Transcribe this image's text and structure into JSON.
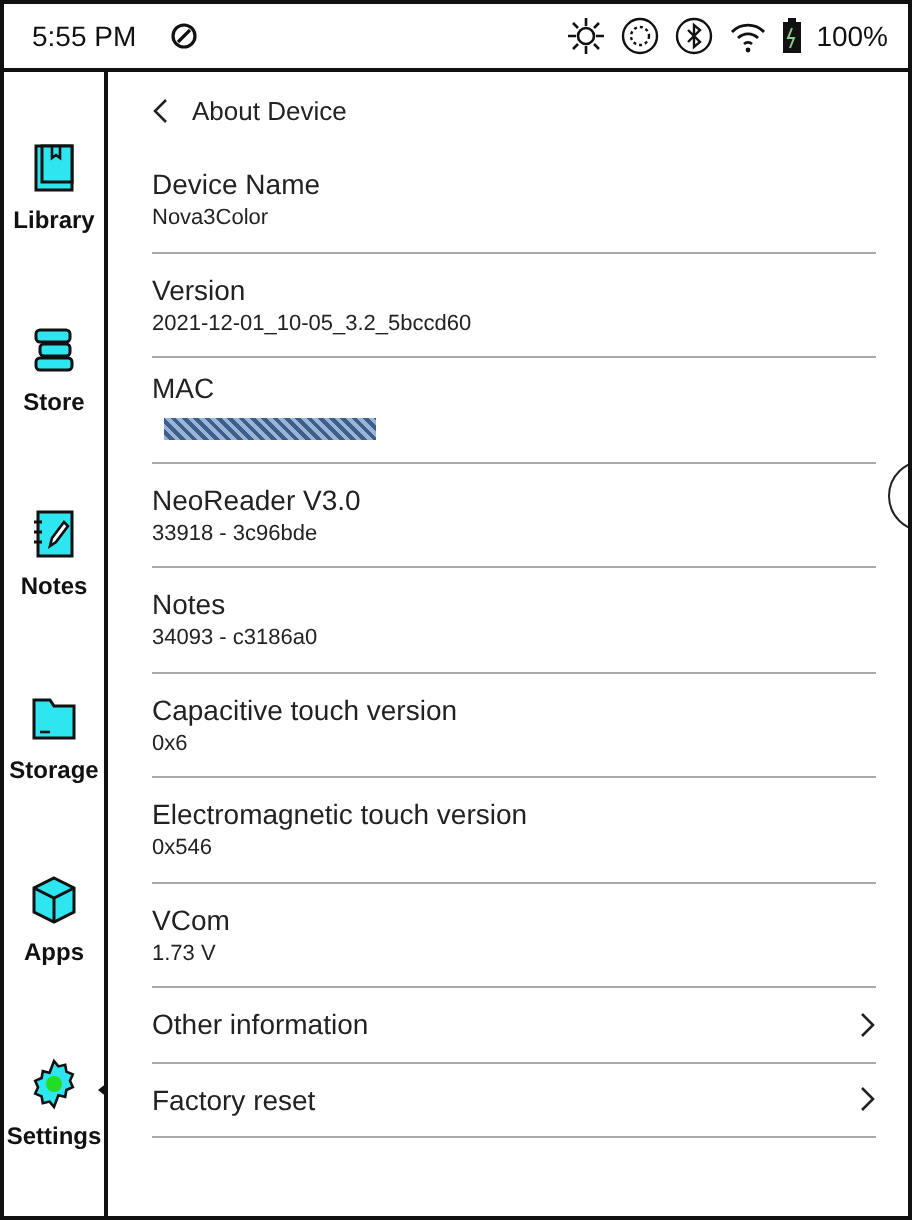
{
  "status_bar": {
    "time": "5:55 PM",
    "battery": "100%"
  },
  "sidebar": {
    "items": [
      {
        "label": "Library",
        "selected": false
      },
      {
        "label": "Store",
        "selected": false
      },
      {
        "label": "Notes",
        "selected": false
      },
      {
        "label": "Storage",
        "selected": false
      },
      {
        "label": "Apps",
        "selected": false
      },
      {
        "label": "Settings",
        "selected": true
      }
    ]
  },
  "header": {
    "title": "About Device"
  },
  "rows": [
    {
      "kind": "info",
      "label": "Device Name",
      "value": "Nova3Color"
    },
    {
      "kind": "info",
      "label": "Version",
      "value": "2021-12-01_10-05_3.2_5bccd60"
    },
    {
      "kind": "redacted",
      "label": "MAC"
    },
    {
      "kind": "info",
      "label": "NeoReader V3.0",
      "value": "33918 - 3c96bde"
    },
    {
      "kind": "info",
      "label": "Notes",
      "value": "34093 - c3186a0"
    },
    {
      "kind": "info",
      "label": "Capacitive touch version",
      "value": "0x6"
    },
    {
      "kind": "info",
      "label": "Electromagnetic touch version",
      "value": "0x546"
    },
    {
      "kind": "info",
      "label": "VCom",
      "value": "1.73 V"
    },
    {
      "kind": "link",
      "label": "Other information"
    },
    {
      "kind": "link",
      "label": "Factory reset"
    }
  ]
}
